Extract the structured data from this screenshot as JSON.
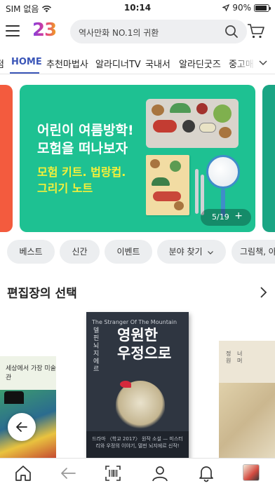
{
  "status_bar": {
    "carrier": "SIM 없음",
    "time": "10:14",
    "battery": "90%",
    "battery_level": 0.9,
    "icons": [
      "wifi-icon",
      "location-arrow-icon",
      "battery-icon"
    ]
  },
  "header": {
    "logo": "23",
    "search_placeholder": "역사만화 NO.1의 귀환",
    "icons": [
      "menu-icon",
      "search-icon",
      "cart-icon"
    ]
  },
  "tabs": {
    "items": [
      {
        "label": "점"
      },
      {
        "label": "HOME",
        "active": true
      },
      {
        "label": "추천마법사"
      },
      {
        "label": "알라디너TV"
      },
      {
        "label": "국내서"
      },
      {
        "label": "알라딘굿즈"
      },
      {
        "label": "중고매"
      }
    ]
  },
  "banner": {
    "title_line1": "어린이 여름방학!",
    "title_line2": "모험을 떠나보자",
    "sub_line1": "모험 키트. 법랑컵.",
    "sub_line2": "그리기 노트",
    "counter": "5/19",
    "counter_plus": "+",
    "colors": {
      "background": "#1ec192",
      "subtitle": "#f5f03a",
      "prev": "#f35b3e",
      "next": "#1aa584"
    }
  },
  "chips": [
    {
      "label": "베스트"
    },
    {
      "label": "신간"
    },
    {
      "label": "이벤트"
    },
    {
      "label": "분야 찾기"
    },
    {
      "label": "그림책, 아"
    }
  ],
  "editor_pick": {
    "title": "편집장의 선택",
    "books": {
      "left": {
        "title": "세상에서 가장 미술관"
      },
      "main": {
        "small_text": "The Stranger Of The Mountain",
        "title_line1": "영원한",
        "title_line2": "우정으로",
        "vertical_text": "델핀 뇌지에르",
        "band_text": "드라마 〈학교 2017〉 원작 소설 — 미스터리와 우정의 이야기, 델핀 뇌지에르 신작!"
      },
      "right": {
        "title_line1": "정원",
        "title_line2": "너머"
      }
    }
  },
  "bottom_nav": {
    "items": [
      "home-icon",
      "back-arrow-icon",
      "barcode-scan-icon",
      "profile-icon",
      "bell-icon",
      "recent-book-thumbnail"
    ]
  },
  "accent_color": "#3b56b8"
}
